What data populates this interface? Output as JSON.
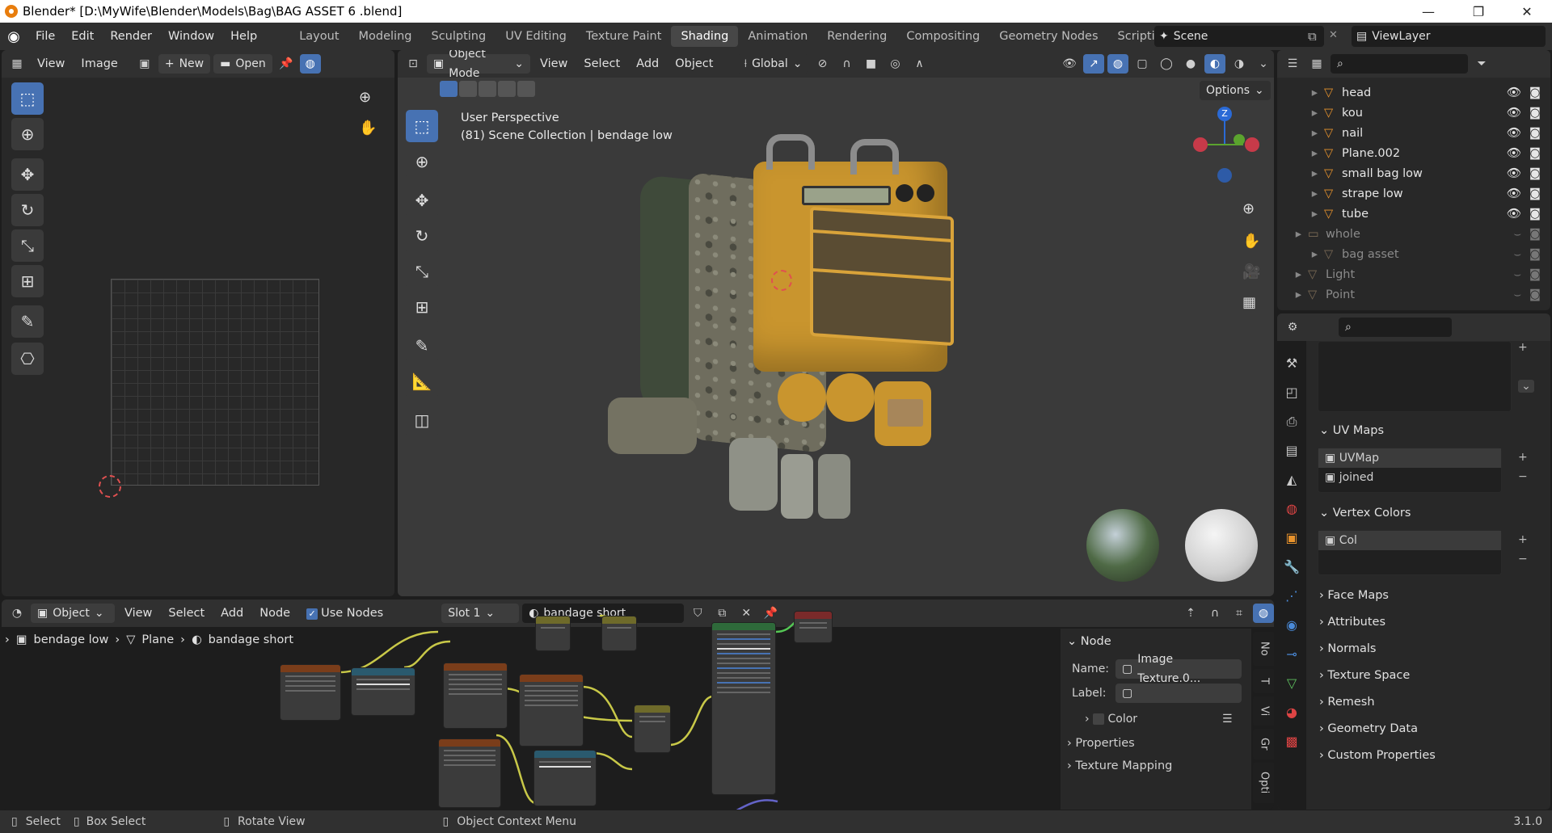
{
  "titlebar": {
    "title": "Blender* [D:\\MyWife\\Blender\\Models\\Bag\\BAG ASSET 6 .blend]",
    "minimize": "—",
    "maximize": "❐",
    "close": "✕"
  },
  "menu": [
    "File",
    "Edit",
    "Render",
    "Window",
    "Help"
  ],
  "workspaces": {
    "tabs": [
      "Layout",
      "Modeling",
      "Sculpting",
      "UV Editing",
      "Texture Paint",
      "Shading",
      "Animation",
      "Rendering",
      "Compositing",
      "Geometry Nodes",
      "Scripting"
    ],
    "active": "Shading",
    "add": "+"
  },
  "scene": {
    "label": "Scene",
    "viewlayer": "ViewLayer"
  },
  "image_editor": {
    "view": "View",
    "image": "Image",
    "new": "New",
    "open": "Open"
  },
  "viewport": {
    "mode": "Object Mode",
    "menus": [
      "View",
      "Select",
      "Add",
      "Object"
    ],
    "transform": "Global",
    "options": "Options",
    "perspective": "User Perspective",
    "collection": "(81) Scene Collection | bendage low",
    "gizmo_z": "Z"
  },
  "outliner": {
    "rows": [
      {
        "name": "head",
        "dim": false
      },
      {
        "name": "kou",
        "dim": false
      },
      {
        "name": "nail",
        "dim": false
      },
      {
        "name": "Plane.002",
        "dim": false
      },
      {
        "name": "small bag low",
        "dim": false
      },
      {
        "name": "strape low",
        "dim": false
      },
      {
        "name": "tube",
        "dim": false
      },
      {
        "name": "whole",
        "dim": true
      },
      {
        "name": "bag asset",
        "dim": true
      },
      {
        "name": "Light",
        "dim": true
      },
      {
        "name": "Point",
        "dim": true
      }
    ]
  },
  "properties": {
    "uv_maps": {
      "title": "UV Maps",
      "items": [
        "UVMap",
        "joined"
      ]
    },
    "vertex_colors": {
      "title": "Vertex Colors",
      "items": [
        "Col"
      ]
    },
    "collapsed_panels": [
      "Face Maps",
      "Attributes",
      "Normals",
      "Texture Space",
      "Remesh",
      "Geometry Data",
      "Custom Properties"
    ]
  },
  "node_editor": {
    "type": "Object",
    "menus": [
      "View",
      "Select",
      "Add",
      "Node"
    ],
    "use_nodes": "Use Nodes",
    "slot": "Slot 1",
    "material": "bandage short",
    "breadcrumb": [
      "bendage low",
      "Plane",
      "bandage short"
    ]
  },
  "node_panel": {
    "title": "Node",
    "name_label": "Name:",
    "name_value": "Image Texture.0...",
    "label_label": "Label:",
    "color": "Color",
    "properties": "Properties",
    "texture_mapping": "Texture Mapping",
    "side_tabs": [
      "No",
      "T",
      "Vi",
      "Gr",
      "Opti"
    ]
  },
  "status": {
    "select": "Select",
    "box_select": "Box Select",
    "rotate": "Rotate View",
    "context": "Object Context Menu",
    "version": "3.1.0"
  },
  "colors": {
    "accent": "#4772b3",
    "header": "#303030",
    "panel": "#282828",
    "orange": "#e87d0d"
  }
}
